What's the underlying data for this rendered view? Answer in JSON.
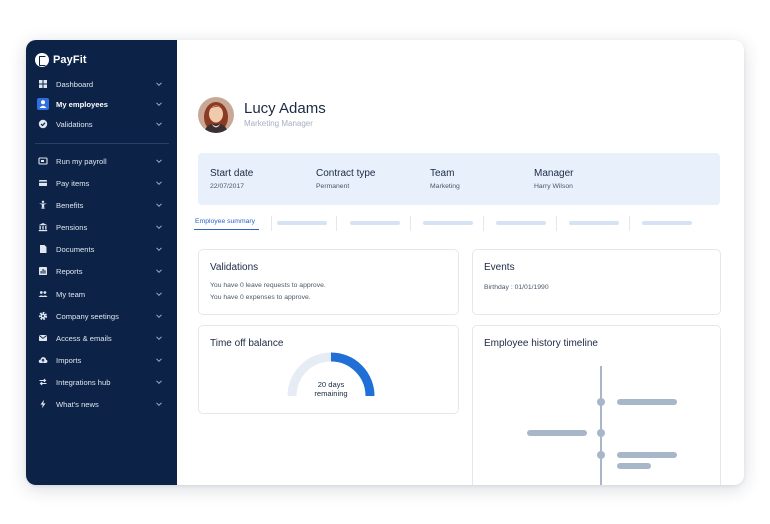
{
  "app": {
    "brand": "PayFit"
  },
  "colors": {
    "sidebar": "#0c2347",
    "accent": "#2f6fe0",
    "info_bg": "#e7f0fb",
    "gauge_fill": "#1f6fd6",
    "gauge_track": "#e6ecf4",
    "timeline": "#a7b6c9"
  },
  "sidebar": {
    "items": [
      {
        "label": "Dashboard",
        "icon": "dashboard-grid-icon"
      },
      {
        "label": "My employees",
        "icon": "person-icon",
        "active": true
      },
      {
        "label": "Validations",
        "icon": "check-circle-icon"
      },
      {
        "label": "Run my payroll",
        "icon": "payroll-icon"
      },
      {
        "label": "Pay items",
        "icon": "card-icon"
      },
      {
        "label": "Benefits",
        "icon": "figure-icon"
      },
      {
        "label": "Pensions",
        "icon": "bank-icon"
      },
      {
        "label": "Documents",
        "icon": "document-icon"
      },
      {
        "label": "Reports",
        "icon": "report-icon"
      },
      {
        "label": "My team",
        "icon": "team-icon"
      },
      {
        "label": "Company seetings",
        "icon": "gear-icon"
      },
      {
        "label": "Access & emails",
        "icon": "mail-icon"
      },
      {
        "label": "Imports",
        "icon": "cloud-upload-icon"
      },
      {
        "label": "Integrations hub",
        "icon": "arrows-icon"
      },
      {
        "label": "What's news",
        "icon": "bolt-icon"
      }
    ]
  },
  "employee": {
    "name": "Lucy Adams",
    "role": "Marketing Manager",
    "fields": [
      {
        "title": "Start date",
        "value": "22/07/2017"
      },
      {
        "title": "Contract type",
        "value": "Permanent"
      },
      {
        "title": "Team",
        "value": "Marketing"
      },
      {
        "title": "Manager",
        "value": "Harry Wilson"
      }
    ]
  },
  "tabs": {
    "active": "Employee summary"
  },
  "validations": {
    "title": "Validations",
    "lines": [
      "You have 0 leave requests to approve.",
      "You have 0 expenses to approve."
    ]
  },
  "events": {
    "title": "Events",
    "birthday": "Birthday : 01/01/1990"
  },
  "time_off": {
    "title": "Time off balance",
    "remaining_line1": "20 days",
    "remaining_line2": "remaining",
    "fill_fraction": 0.5
  },
  "history": {
    "title": "Employee history timeline"
  }
}
